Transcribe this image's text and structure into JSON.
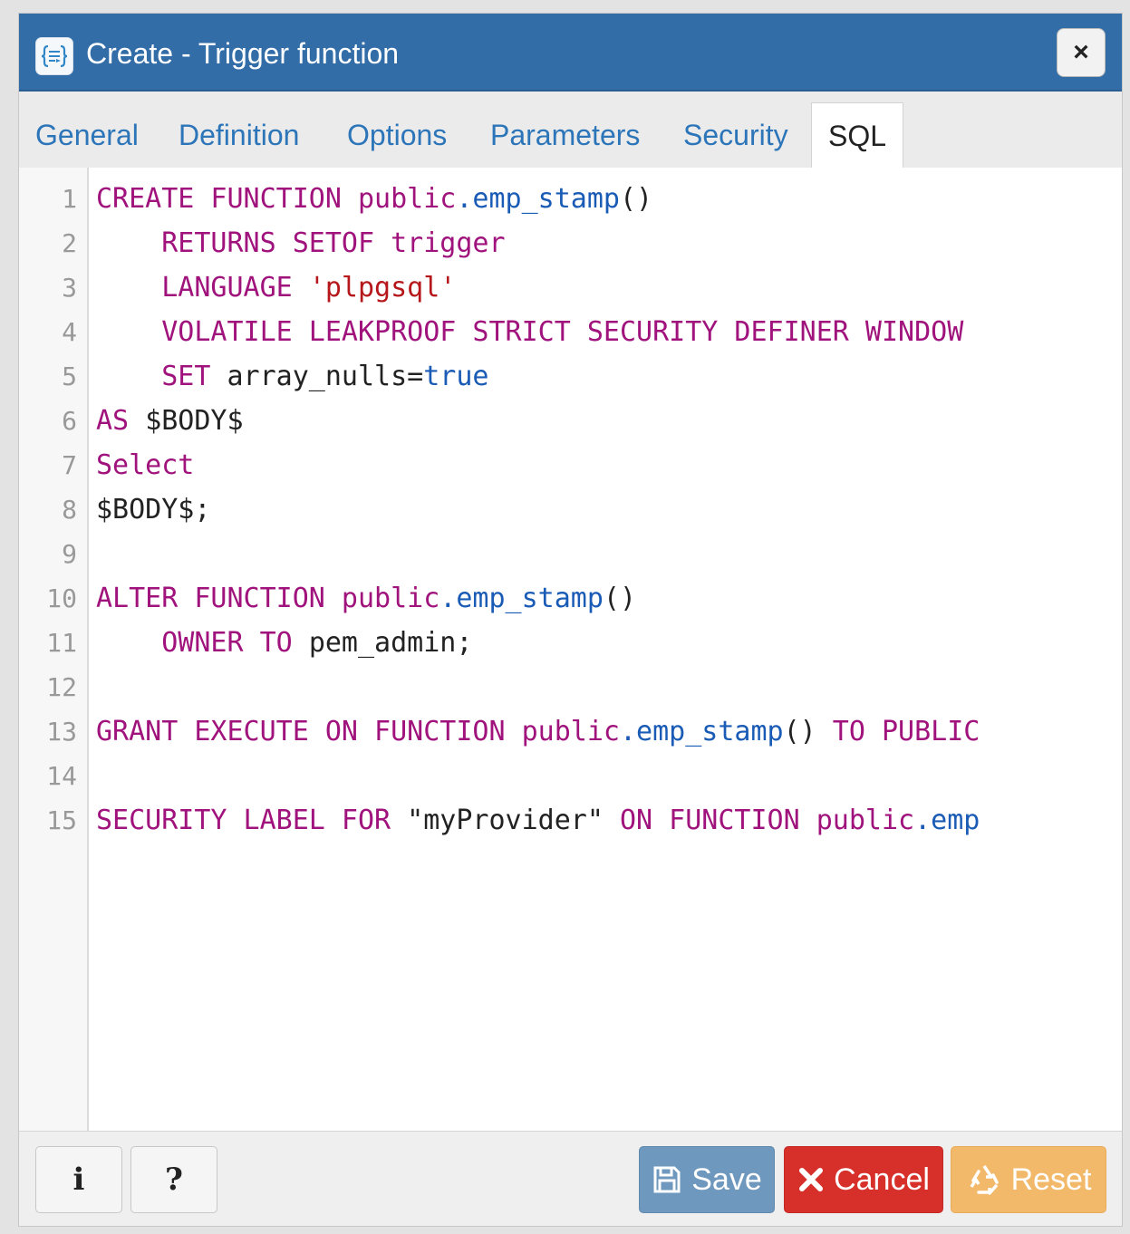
{
  "window": {
    "title": "Create - Trigger function",
    "title_icon": "trigger-function-icon",
    "close_label": "×"
  },
  "tabs": [
    {
      "label": "General",
      "active": false
    },
    {
      "label": "Definition",
      "active": false
    },
    {
      "label": "Options",
      "active": false
    },
    {
      "label": "Parameters",
      "active": false
    },
    {
      "label": "Security",
      "active": false
    },
    {
      "label": "SQL",
      "active": true
    }
  ],
  "editor": {
    "lines": [
      {
        "n": "1",
        "tokens": [
          {
            "t": "CREATE FUNCTION public",
            "c": "kw"
          },
          {
            "t": ".emp_stamp",
            "c": "var"
          },
          {
            "t": "()",
            "c": "plain"
          }
        ]
      },
      {
        "n": "2",
        "tokens": [
          {
            "t": "    RETURNS SETOF trigger",
            "c": "kw"
          }
        ]
      },
      {
        "n": "3",
        "tokens": [
          {
            "t": "    LANGUAGE ",
            "c": "kw"
          },
          {
            "t": "'plpgsql'",
            "c": "str"
          }
        ]
      },
      {
        "n": "4",
        "tokens": [
          {
            "t": "    VOLATILE LEAKPROOF STRICT SECURITY DEFINER WINDOW",
            "c": "kw"
          }
        ]
      },
      {
        "n": "5",
        "tokens": [
          {
            "t": "    SET ",
            "c": "kw"
          },
          {
            "t": "array_nulls=",
            "c": "plain"
          },
          {
            "t": "true",
            "c": "var"
          }
        ]
      },
      {
        "n": "6",
        "tokens": [
          {
            "t": "AS ",
            "c": "kw"
          },
          {
            "t": "$BODY$",
            "c": "plain"
          }
        ]
      },
      {
        "n": "7",
        "tokens": [
          {
            "t": "Select",
            "c": "kw"
          }
        ]
      },
      {
        "n": "8",
        "tokens": [
          {
            "t": "$BODY$;",
            "c": "plain"
          }
        ]
      },
      {
        "n": "9",
        "tokens": []
      },
      {
        "n": "10",
        "tokens": [
          {
            "t": "ALTER FUNCTION public",
            "c": "kw"
          },
          {
            "t": ".emp_stamp",
            "c": "var"
          },
          {
            "t": "()",
            "c": "plain"
          }
        ]
      },
      {
        "n": "11",
        "tokens": [
          {
            "t": "    OWNER TO ",
            "c": "kw"
          },
          {
            "t": "pem_admin;",
            "c": "plain"
          }
        ]
      },
      {
        "n": "12",
        "tokens": []
      },
      {
        "n": "13",
        "tokens": [
          {
            "t": "GRANT EXECUTE ON FUNCTION public",
            "c": "kw"
          },
          {
            "t": ".emp_stamp",
            "c": "var"
          },
          {
            "t": "() ",
            "c": "plain"
          },
          {
            "t": "TO PUBLIC",
            "c": "kw"
          }
        ]
      },
      {
        "n": "14",
        "tokens": []
      },
      {
        "n": "15",
        "tokens": [
          {
            "t": "SECURITY LABEL FOR ",
            "c": "kw"
          },
          {
            "t": "\"myProvider\" ",
            "c": "plain"
          },
          {
            "t": "ON FUNCTION public",
            "c": "kw"
          },
          {
            "t": ".emp",
            "c": "var"
          }
        ]
      }
    ]
  },
  "footer": {
    "info_label": "i",
    "help_label": "?",
    "save_label": "Save",
    "cancel_label": "Cancel",
    "reset_label": "Reset"
  },
  "colors": {
    "titlebar": "#326da8",
    "keyword": "#a0137c",
    "string": "#b5171b",
    "variable": "#1a5bb5",
    "save": "#6e98bd",
    "cancel": "#d7302b",
    "reset": "#f3b96a"
  }
}
